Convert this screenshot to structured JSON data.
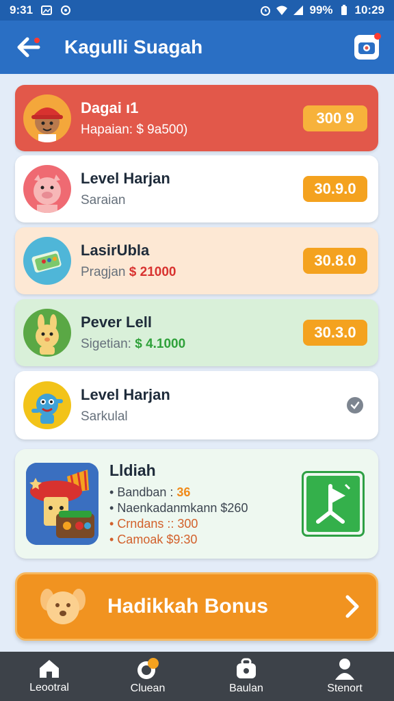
{
  "status": {
    "time": "9:31",
    "battery": "99%",
    "clock": "10:29"
  },
  "header": {
    "title": "Kagulli Suagah",
    "back_icon": "back-arrow-icon",
    "camera_icon": "camera-icon"
  },
  "items": [
    {
      "title": "Dagai ı1",
      "subtitle": "Hapaian: $ 9a500)",
      "price": "300 9",
      "avatar": "girl-avatar-icon"
    },
    {
      "title": "Level Harjan",
      "subtitle": "Saraian",
      "price": "30.9.0",
      "avatar": "pig-avatar-icon"
    },
    {
      "title": "LasirUbla",
      "subtitle_prefix": "Pragjan",
      "subtitle_amount": "$ 21000",
      "price": "30.8.0",
      "avatar": "money-avatar-icon"
    },
    {
      "title": "Pever Lell",
      "subtitle_prefix": "Sigetian:",
      "subtitle_amount": "$ 4.1000",
      "price": "30.3.0",
      "avatar": "bunny-avatar-icon"
    },
    {
      "title": "Level Harjan",
      "subtitle": "Sarkulal",
      "avatar": "monster-avatar-icon",
      "status": "check-icon"
    }
  ],
  "reward": {
    "title": "Lldiah",
    "lines": [
      {
        "text": "Bandban :",
        "value": "36"
      },
      {
        "text": "Naenkadanmkann $260"
      },
      {
        "text": "Crndans :: 300"
      },
      {
        "text": "Camoak $9:30"
      }
    ],
    "image": "treasure-chest-icon",
    "action_icon": "flag-icon"
  },
  "bonus": {
    "label": "Hadikkah Bonus",
    "icon": "puppy-icon",
    "arrow": "chevron-right-icon"
  },
  "nav": [
    {
      "label": "Leootral",
      "icon": "home-icon"
    },
    {
      "label": "Cluean",
      "icon": "coin-icon"
    },
    {
      "label": "Baulan",
      "icon": "bag-icon"
    },
    {
      "label": "Stenort",
      "icon": "profile-icon"
    }
  ],
  "colors": {
    "appbar": "#2a6fc4",
    "price": "#f4a21f",
    "bonus": "#f19320",
    "nav": "#3d4249"
  }
}
